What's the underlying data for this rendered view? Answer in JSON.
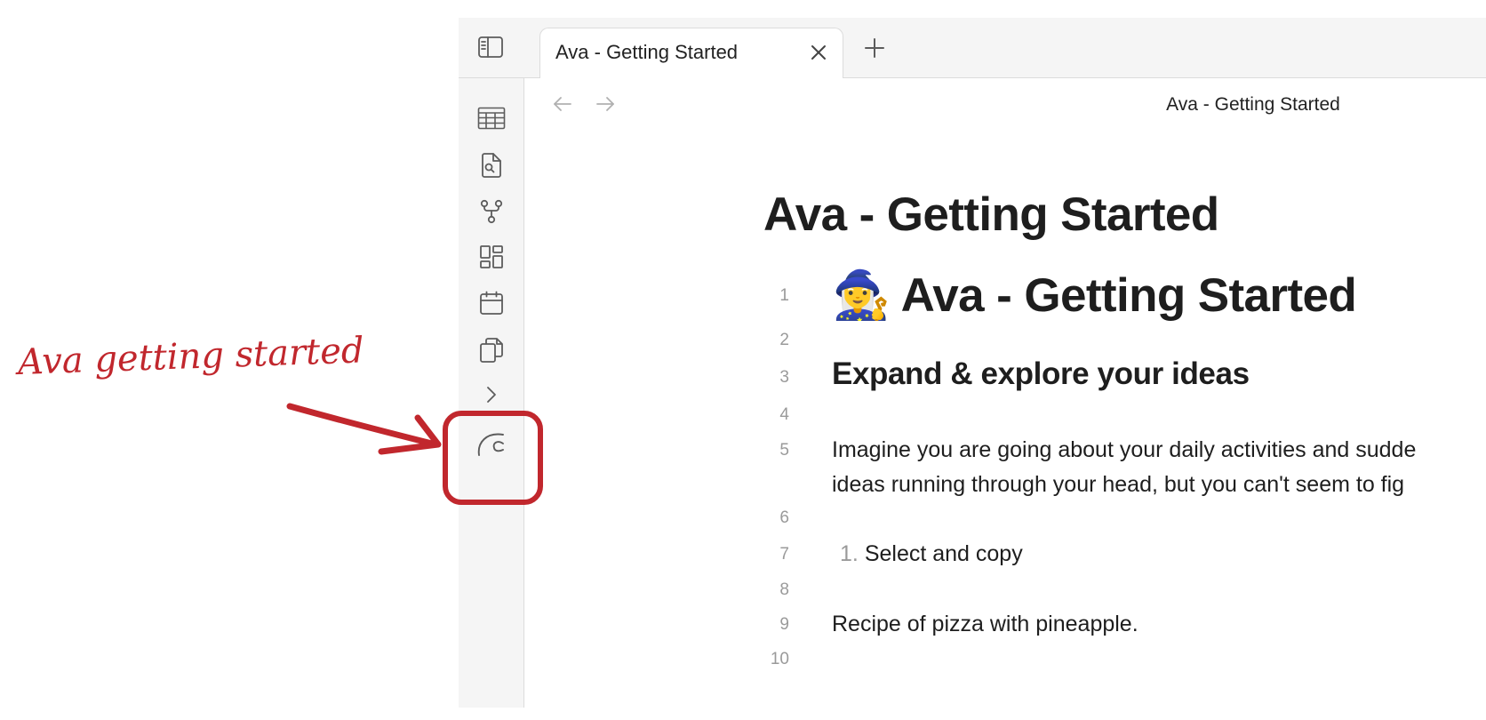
{
  "tab": {
    "label": "Ava - Getting Started"
  },
  "header": {
    "title": "Ava - Getting Started"
  },
  "ribbon": {
    "icons": [
      "table-icon",
      "file-search-icon",
      "git-fork-icon",
      "dashboard-icon",
      "calendar-icon",
      "copy-icon",
      "chevron-right-icon",
      "ava-icon"
    ]
  },
  "note": {
    "inline_title": "Ava - Getting Started",
    "lines": [
      {
        "num": "1",
        "text": "Ava - Getting Started",
        "emoji": "🧙‍♀️"
      },
      {
        "num": "2",
        "text": ""
      },
      {
        "num": "3",
        "text": "Expand & explore your ideas"
      },
      {
        "num": "4",
        "text": ""
      },
      {
        "num": "5",
        "text": "Imagine you are going about your daily activities and sudde",
        "text2": "ideas running through your head, but you can't seem to fig"
      },
      {
        "num": "6",
        "text": ""
      },
      {
        "num": "7",
        "list_marker": "1.",
        "text": "Select and copy"
      },
      {
        "num": "8",
        "text": ""
      },
      {
        "num": "9",
        "text": "Recipe of pizza with pineapple."
      },
      {
        "num": "10",
        "text": ""
      }
    ]
  },
  "annotation": {
    "text": "Ava getting started",
    "color": "#c1272d"
  },
  "colors": {
    "chrome_bg": "#f5f5f5",
    "border": "#dcdcdc",
    "icon": "#5c5c5c",
    "text": "#1e1e1e",
    "muted": "#9a9a9a",
    "annotation": "#c1272d"
  }
}
